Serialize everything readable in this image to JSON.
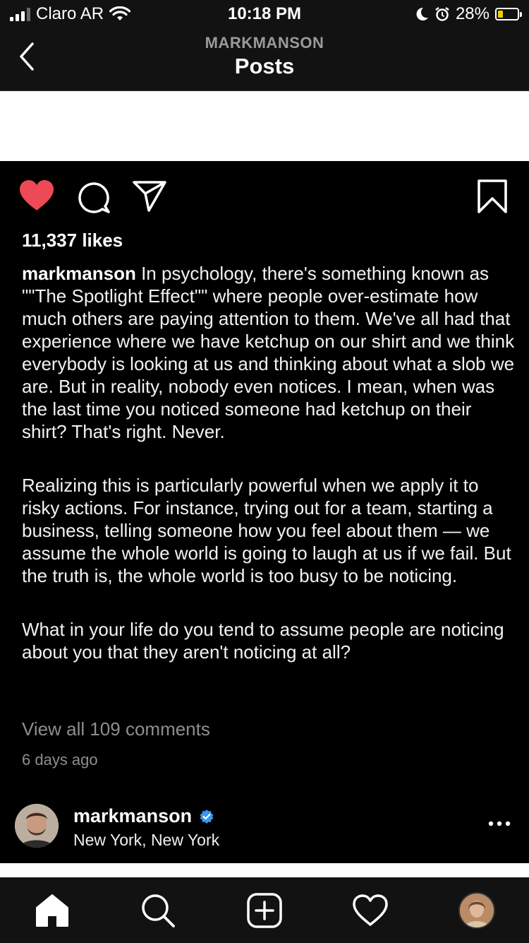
{
  "status_bar": {
    "carrier": "Claro AR",
    "time": "10:18 PM",
    "battery_percent": "28%",
    "battery_level": 0.28,
    "battery_color": "#e8d000",
    "icons": [
      "signal-icon",
      "wifi-icon",
      "moon-icon",
      "alarm-icon",
      "battery-icon"
    ]
  },
  "header": {
    "subtitle": "MARKMANSON",
    "title": "Posts",
    "back_icon": "chevron-left-icon"
  },
  "post": {
    "liked": true,
    "like_color": "#ed4956",
    "likes": "11,337 likes",
    "caption_user": "markmanson",
    "caption_first": " In psychology, there's something known as \"\"The Spotlight Effect\"\" where people over-estimate how much others are paying attention to them. We've all had that experience where we have ketchup on our shirt and we think everybody is looking at us and thinking about what a slob we are. But in reality, nobody even notices. I mean, when was the last time you noticed someone had ketchup on their shirt? That's right. Never.",
    "caption_second": "Realizing this is particularly powerful when we apply it to risky actions. For instance, trying out for a team, starting a business, telling someone how you feel about them — we assume the whole world is going to laugh at us if we fail. But the truth is, the whole world is too busy to be noticing.",
    "caption_third": "What in your life do you tend to assume people are noticing about you that they aren't noticing at all?",
    "view_comments": "View all 109 comments",
    "time_ago": "6 days ago"
  },
  "next_post": {
    "username": "markmanson",
    "verified": true,
    "verified_color": "#3897f0",
    "location": "New York, New York"
  },
  "tab_bar": {
    "items": [
      "home-icon",
      "search-icon",
      "add-post-icon",
      "activity-heart-icon",
      "profile-avatar"
    ]
  }
}
